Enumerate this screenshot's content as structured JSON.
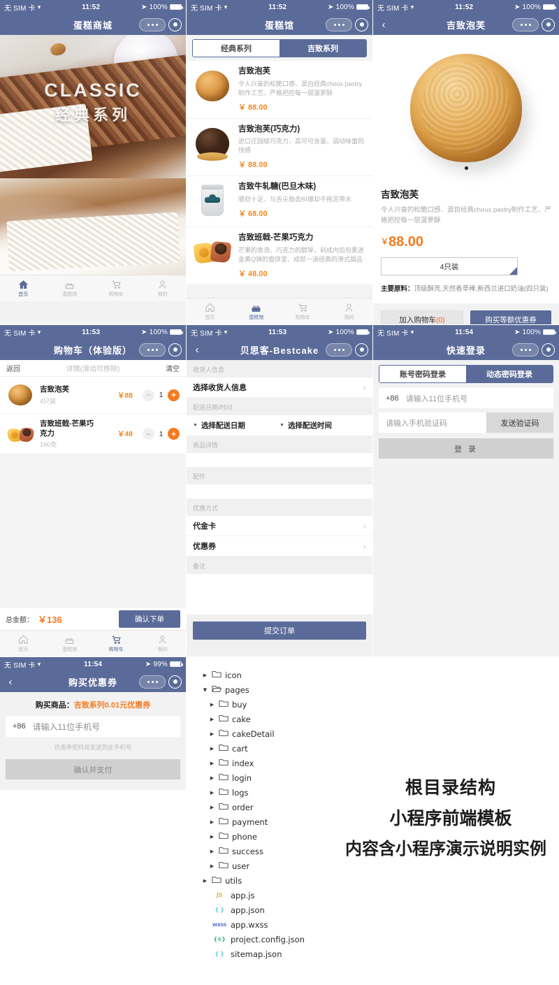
{
  "status": {
    "carrier": "无 SIM 卡",
    "wifi": "wifi-icon",
    "times": {
      "t1152": "11:52",
      "t1153": "11:53",
      "t1154": "11:54"
    },
    "battery_100": "100%",
    "battery_99": "99%"
  },
  "tabbar": {
    "items": [
      {
        "label": "首页",
        "icon": "home-icon"
      },
      {
        "label": "蛋糕馆",
        "icon": "cake-icon"
      },
      {
        "label": "购物车",
        "icon": "cart-icon"
      },
      {
        "label": "我的",
        "icon": "user-icon"
      }
    ]
  },
  "panel_index": {
    "nav_title": "蛋糕商城",
    "hero": {
      "en": "CLASSIC",
      "cn": "经典系列"
    }
  },
  "panel_cake": {
    "nav_title": "蛋糕馆",
    "tabs": [
      {
        "label": "经典系列",
        "active": false
      },
      {
        "label": "吉致系列",
        "active": true
      }
    ],
    "products": [
      {
        "name": "吉致泡芙",
        "desc": "令人兴奋的松脆口感、源自经典choux pastry制作工艺、严格把控每一层菠萝酥",
        "price": "￥ 88.00",
        "thumb": "puff-plain"
      },
      {
        "name": "吉致泡芙(巧克力)",
        "desc": "进口庄园级巧克力、高可可含量、调动味蕾的快感",
        "price": "￥ 88.00",
        "thumb": "puff-chocolate"
      },
      {
        "name": "吉致牛轧糖(巴旦木味)",
        "desc": "嚼劲十足、与舌尖唇齿纠缠却不拖泥带水",
        "price": "￥ 68.00",
        "thumb": "nougat-jar"
      },
      {
        "name": "吉致班戟-芒果巧克力",
        "desc": "芒果的香滑、巧克力的醇厚，剁成内馅包裹进金黄Q弹的面饼里、成就一道经典的港式甜品",
        "price": "￥ 48.00",
        "thumb": "mango-pancake"
      }
    ]
  },
  "panel_detail": {
    "nav_title": "吉致泡芙",
    "title": "吉致泡芙",
    "desc": "令人兴奋的松脆口感、源自经典choux pastry制作工艺、严格把控每一层菠萝酥",
    "currency": "￥",
    "price": "88.00",
    "spec_selected": "4只装",
    "ingredients_label": "主要原料：",
    "ingredients_value": "顶级酥壳,天然香草棒,新西兰进口奶油(四只装)",
    "add_cart_label": "加入购物车",
    "add_cart_count": "(0)",
    "buy_label": "购买等额优惠券"
  },
  "panel_cart": {
    "nav_title": "购物车（体验版）",
    "back_label": "返回",
    "hint": "详情(滑动可移除)",
    "clear_label": "清空",
    "items": [
      {
        "name": "吉致泡芙",
        "spec": "4只装",
        "price": "￥88",
        "qty": "1",
        "thumb": "puff-plain"
      },
      {
        "name": "吉致班戟-芒果巧克力",
        "spec": "160克",
        "price": "￥48",
        "qty": "1",
        "thumb": "mango-pancake"
      }
    ],
    "total_label": "总金额：",
    "total_amount": "￥136",
    "confirm_label": "确认下单",
    "minus": "−",
    "plus": "+"
  },
  "panel_order": {
    "nav_title": "贝思客-Bestcake",
    "sec_receiver": "收货人信息",
    "row_receiver": "选择收货人信息",
    "sec_delivery": "配送日期/时间",
    "picker_date": "选择配送日期",
    "picker_time": "选择配送时间",
    "sec_goods": "商品详情",
    "sec_parts": "配件",
    "sec_discount": "优惠方式",
    "row_voucher": "代金卡",
    "row_coupon": "优惠券",
    "sec_note": "备注",
    "submit_label": "提交订单",
    "chevron": "›"
  },
  "panel_login": {
    "nav_title": "快速登录",
    "tabs": [
      {
        "label": "账号密码登录",
        "active": false
      },
      {
        "label": "动态密码登录",
        "active": true
      }
    ],
    "country_code": "+86",
    "phone_placeholder": "请输入11位手机号",
    "code_placeholder": "请输入手机验证码",
    "send_code_label": "发送验证码",
    "login_label": "登 录"
  },
  "panel_coupon": {
    "nav_title": "购买优惠券",
    "buy_label": "购买商品：",
    "buy_product": "吉致系列0.01元优惠券",
    "country_code": "+86",
    "phone_placeholder": "请输入11位手机号",
    "hint": "优惠券密码将发送到此手机号",
    "pay_label": "确认并支付"
  },
  "file_tree": [
    {
      "name": "icon",
      "type": "folder",
      "depth": 0,
      "arrow": "▶"
    },
    {
      "name": "pages",
      "type": "folder-open",
      "depth": 0,
      "arrow": "▼"
    },
    {
      "name": "buy",
      "type": "folder",
      "depth": 1,
      "arrow": "▶"
    },
    {
      "name": "cake",
      "type": "folder",
      "depth": 1,
      "arrow": "▶"
    },
    {
      "name": "cakeDetail",
      "type": "folder",
      "depth": 1,
      "arrow": "▶"
    },
    {
      "name": "cart",
      "type": "folder",
      "depth": 1,
      "arrow": "▶"
    },
    {
      "name": "index",
      "type": "folder",
      "depth": 1,
      "arrow": "▶"
    },
    {
      "name": "login",
      "type": "folder",
      "depth": 1,
      "arrow": "▶"
    },
    {
      "name": "logs",
      "type": "folder",
      "depth": 1,
      "arrow": "▶"
    },
    {
      "name": "order",
      "type": "folder",
      "depth": 1,
      "arrow": "▶"
    },
    {
      "name": "payment",
      "type": "folder",
      "depth": 1,
      "arrow": "▶"
    },
    {
      "name": "phone",
      "type": "folder",
      "depth": 1,
      "arrow": "▶"
    },
    {
      "name": "success",
      "type": "folder",
      "depth": 1,
      "arrow": "▶"
    },
    {
      "name": "user",
      "type": "folder",
      "depth": 1,
      "arrow": "▶"
    },
    {
      "name": "utils",
      "type": "folder",
      "depth": 0,
      "arrow": "▶"
    },
    {
      "name": "app.js",
      "type": "js",
      "depth": 1,
      "icon": "JS"
    },
    {
      "name": "app.json",
      "type": "json",
      "depth": 1,
      "icon": "{ }"
    },
    {
      "name": "app.wxss",
      "type": "wxss",
      "depth": 1,
      "icon": "WXSS"
    },
    {
      "name": "project.config.json",
      "type": "cfg",
      "depth": 1,
      "icon": "{⊙}"
    },
    {
      "name": "sitemap.json",
      "type": "json",
      "depth": 1,
      "icon": "{ }"
    }
  ],
  "promo": {
    "line1": "根目录结构",
    "line2": "小程序前端模板",
    "line3": "内容含小程序演示说明实例"
  },
  "colors": {
    "brand": "#5b6b99",
    "accent_orange": "#f47b20",
    "price_orange": "#f08a24",
    "muted": "#b0b0b0"
  }
}
